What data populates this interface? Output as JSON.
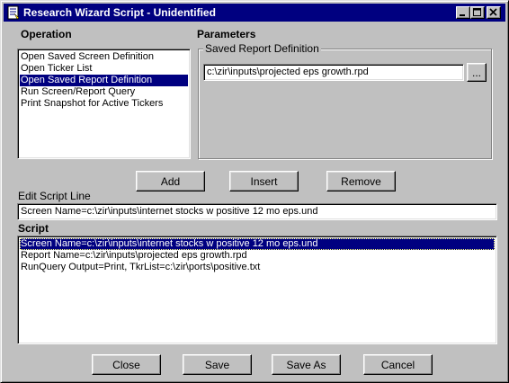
{
  "window": {
    "title": "Research Wizard Script - Unidentified",
    "controls": {
      "minimize": "minimize-icon",
      "maximize": "maximize-icon",
      "close": "close-icon"
    }
  },
  "operation": {
    "label": "Operation",
    "items": [
      "Open Saved Screen Definition",
      "Open Ticker List",
      "Open Saved Report Definition",
      "Run Screen/Report Query",
      "Print Snapshot for Active Tickers"
    ],
    "selected_index": 2
  },
  "parameters": {
    "label": "Parameters",
    "group_label": "Saved Report Definition",
    "path_value": "c:\\zir\\inputs\\projected eps growth.rpd",
    "browse_label": "..."
  },
  "actions": {
    "add": "Add",
    "insert": "Insert",
    "remove": "Remove"
  },
  "edit": {
    "label": "Edit Script Line",
    "value": "Screen Name=c:\\zir\\inputs\\internet stocks w positive 12 mo eps.und"
  },
  "script": {
    "label": "Script",
    "lines": [
      "Screen Name=c:\\zir\\inputs\\internet stocks w positive 12 mo eps.und",
      "Report Name=c:\\zir\\inputs\\projected eps growth.rpd",
      "RunQuery  Output=Print, TkrList=c:\\zir\\ports\\positive.txt"
    ],
    "selected_index": 0
  },
  "footer": {
    "close": "Close",
    "save": "Save",
    "save_as": "Save As",
    "cancel": "Cancel"
  },
  "colors": {
    "face": "#c0c0c0",
    "selection": "#000080",
    "title_bar": "#000080"
  }
}
